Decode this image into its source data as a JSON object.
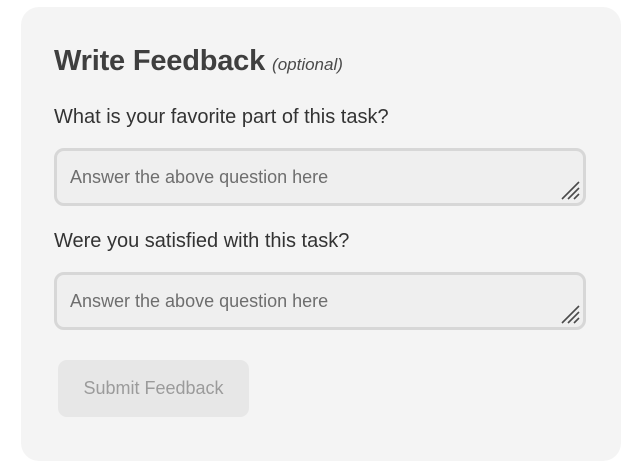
{
  "form": {
    "title": "Write Feedback",
    "optional_note": "(optional)",
    "questions": [
      {
        "label": "What is your favorite part of this task?",
        "placeholder": "Answer the above question here",
        "value": ""
      },
      {
        "label": "Were you satisfied with this task?",
        "placeholder": "Answer the above question here",
        "value": ""
      }
    ],
    "submit_label": "Submit Feedback"
  },
  "icons": {
    "resize_handle": "resize-grip-icon"
  },
  "colors": {
    "card_background": "#f4f4f4",
    "field_border": "#d7d7d7",
    "submit_background": "#e7e7e7",
    "submit_text": "#9b9b9b"
  }
}
